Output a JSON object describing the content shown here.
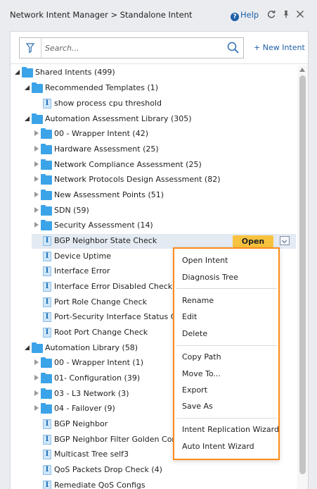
{
  "header": {
    "breadcrumb": "Network Intent Manager  > Standalone Intent",
    "help_label": "Help",
    "icons": [
      "help-circle-icon",
      "refresh-icon",
      "pin-icon",
      "close-icon"
    ]
  },
  "toolbar": {
    "search_placeholder": "Search...",
    "new_intent_label": "+ New Intent"
  },
  "tree": {
    "shared_intents": "Shared Intents (499)",
    "recommended_templates": "Recommended Templates (1)",
    "show_process_cpu": "show process cpu threshold",
    "automation_assessment_library": "Automation Assessment Library (305)",
    "aal_wrapper": "00 - Wrapper Intent (42)",
    "hardware_assessment": "Hardware Assessment (25)",
    "network_compliance": "Network Compliance Assessment (25)",
    "network_protocols": "Network Protocols Design Assessment (82)",
    "new_assessment_points": "New Assessment Points (51)",
    "sdn": "SDN (59)",
    "security_assessment": "Security Assessment (14)",
    "bgp_neighbor_state": "BGP Neighbor State Check",
    "device_uptime": "Device Uptime",
    "interface_error": "Interface Error",
    "interface_error_disabled": "Interface Error Disabled Check",
    "port_role_change": "Port Role Change Check",
    "port_security": "Port-Security Interface Status Che",
    "root_port_change": "Root Port Change Check",
    "automation_library": "Automation Library (58)",
    "al_wrapper": "00 - Wrapper Intent (1)",
    "configuration": "01- Configuration (39)",
    "l3_network": "03 - L3 Network (3)",
    "failover": "04 - Failover (9)",
    "bgp_neighbor": "BGP Neighbor",
    "bgp_neighbor_filter": "BGP Neighbor Filter Golden Confi",
    "multicast_tree": "Multicast Tree self3",
    "qos_packets_drop": "QoS Packets Drop Check (4)",
    "remediate_qos": "Remediate QoS Configs"
  },
  "selected_row": {
    "open_button_label": "Open"
  },
  "context_menu": {
    "groups": [
      [
        "Open Intent",
        "Diagnosis Tree"
      ],
      [
        "Rename",
        "Edit",
        "Delete"
      ],
      [
        "Copy Path",
        "Move To...",
        "Export",
        "Save As"
      ],
      [
        "Intent Replication Wizard",
        "Auto Intent Wizard"
      ]
    ]
  },
  "colors": {
    "accent_link": "#1d5fa8",
    "folder": "#3ba3e8",
    "open_button": "#f7c33f",
    "context_menu_highlight": "#ff8c1a",
    "selected_row": "#e3eaf2"
  }
}
